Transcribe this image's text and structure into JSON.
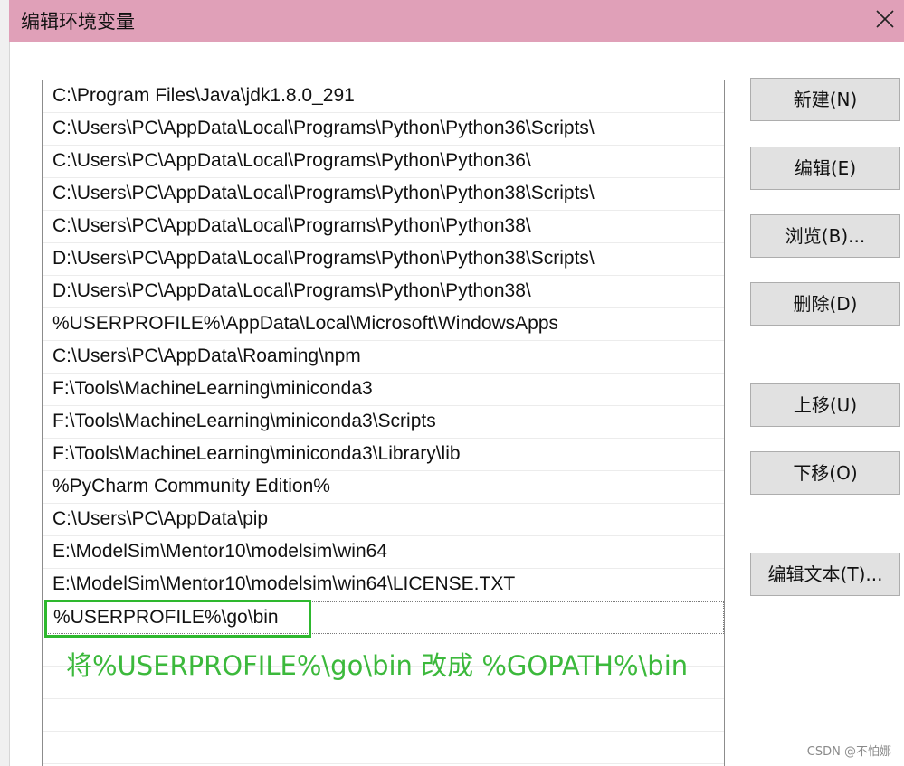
{
  "window": {
    "title": "编辑环境变量"
  },
  "paths": [
    "C:\\Program Files\\Java\\jdk1.8.0_291",
    "C:\\Users\\PC\\AppData\\Local\\Programs\\Python\\Python36\\Scripts\\",
    "C:\\Users\\PC\\AppData\\Local\\Programs\\Python\\Python36\\",
    "C:\\Users\\PC\\AppData\\Local\\Programs\\Python\\Python38\\Scripts\\",
    "C:\\Users\\PC\\AppData\\Local\\Programs\\Python\\Python38\\",
    "D:\\Users\\PC\\AppData\\Local\\Programs\\Python\\Python38\\Scripts\\",
    "D:\\Users\\PC\\AppData\\Local\\Programs\\Python\\Python38\\",
    "%USERPROFILE%\\AppData\\Local\\Microsoft\\WindowsApps",
    "C:\\Users\\PC\\AppData\\Roaming\\npm",
    "F:\\Tools\\MachineLearning\\miniconda3",
    "F:\\Tools\\MachineLearning\\miniconda3\\Scripts",
    "F:\\Tools\\MachineLearning\\miniconda3\\Library\\lib",
    "%PyCharm Community Edition%",
    "C:\\Users\\PC\\AppData\\pip",
    "E:\\ModelSim\\Mentor10\\modelsim\\win64",
    "E:\\ModelSim\\Mentor10\\modelsim\\win64\\LICENSE.TXT",
    "%USERPROFILE%\\go\\bin"
  ],
  "selected_path": "%USERPROFILE%\\go\\bin",
  "annotation": "将%USERPROFILE%\\go\\bin 改成 %GOPATH%\\bin",
  "buttons": {
    "new": "新建(N)",
    "edit": "编辑(E)",
    "browse": "浏览(B)...",
    "delete": "删除(D)",
    "move_up": "上移(U)",
    "move_down": "下移(O)",
    "edit_text": "编辑文本(T)..."
  },
  "watermark": "CSDN @不怕娜",
  "colors": {
    "titlebar": "#e0a0b8",
    "highlight": "#2eb82e",
    "annotation": "#3cb93c"
  }
}
